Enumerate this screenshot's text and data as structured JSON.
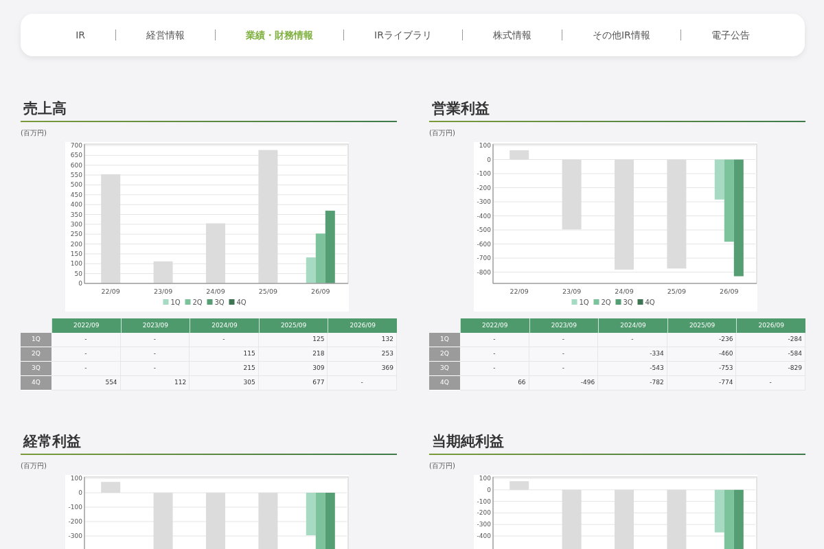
{
  "nav": [
    {
      "label": "IR",
      "selected": false
    },
    {
      "label": "経営情報",
      "selected": false
    },
    {
      "label": "業績・財務情報",
      "selected": true
    },
    {
      "label": "IRライブラリ",
      "selected": false
    },
    {
      "label": "株式情報",
      "selected": false
    },
    {
      "label": "その他IR情報",
      "selected": false
    },
    {
      "label": "電子公告",
      "selected": false
    }
  ],
  "sections": [
    {
      "title": "売上高",
      "unit": "(百万円)",
      "chart_data": {
        "type": "bar",
        "grid": true,
        "legend": true,
        "categories": [
          "22/09",
          "23/09",
          "24/09",
          "25/09",
          "26/09"
        ],
        "ylim": [
          0,
          700
        ],
        "yticks": [
          0,
          50,
          100,
          150,
          200,
          250,
          300,
          350,
          400,
          450,
          500,
          550,
          600,
          650,
          700
        ],
        "series": [
          {
            "name": "1Q",
            "color": "#a6dac3",
            "values": [
              null,
              null,
              null,
              null,
              132
            ]
          },
          {
            "name": "2Q",
            "color": "#7cc39c",
            "values": [
              null,
              null,
              null,
              null,
              253
            ]
          },
          {
            "name": "3Q",
            "color": "#559d72",
            "values": [
              null,
              null,
              null,
              null,
              369
            ]
          },
          {
            "name": "4Q",
            "color": "#3e7452",
            "values": [
              null,
              null,
              null,
              null,
              null
            ]
          },
          {
            "color": "#dcdcdc",
            "values": [
              554,
              112,
              305,
              677,
              null
            ]
          }
        ]
      },
      "table": {
        "columns": [
          "2022/09",
          "2023/09",
          "2024/09",
          "2025/09",
          "2026/09"
        ],
        "rows": [
          {
            "label": "1Q",
            "cells": [
              "-",
              "-",
              "-",
              "125",
              "132"
            ]
          },
          {
            "label": "2Q",
            "cells": [
              "-",
              "-",
              "115",
              "218",
              "253"
            ]
          },
          {
            "label": "3Q",
            "cells": [
              "-",
              "-",
              "215",
              "309",
              "369"
            ]
          },
          {
            "label": "4Q",
            "cells": [
              "554",
              "112",
              "305",
              "677",
              "-"
            ]
          }
        ]
      }
    },
    {
      "title": "営業利益",
      "unit": "(百万円)",
      "chart_data": {
        "type": "bar",
        "grid": true,
        "legend": true,
        "categories": [
          "22/09",
          "23/09",
          "24/09",
          "25/09",
          "26/09"
        ],
        "ylim": [
          -880,
          100
        ],
        "yticks": [
          -800,
          -700,
          -600,
          -500,
          -400,
          -300,
          -200,
          -100,
          0,
          100
        ],
        "series": [
          {
            "name": "1Q",
            "color": "#a6dac3",
            "values": [
              null,
              null,
              null,
              null,
              -284
            ]
          },
          {
            "name": "2Q",
            "color": "#7cc39c",
            "values": [
              null,
              null,
              null,
              null,
              -584
            ]
          },
          {
            "name": "3Q",
            "color": "#559d72",
            "values": [
              null,
              null,
              null,
              null,
              -829
            ]
          },
          {
            "name": "4Q",
            "color": "#3e7452",
            "values": [
              null,
              null,
              null,
              null,
              null
            ]
          },
          {
            "color": "#dcdcdc",
            "values": [
              66,
              -496,
              -782,
              -774,
              null
            ]
          }
        ]
      },
      "table": {
        "columns": [
          "2022/09",
          "2023/09",
          "2024/09",
          "2025/09",
          "2026/09"
        ],
        "rows": [
          {
            "label": "1Q",
            "cells": [
              "-",
              "-",
              "-",
              "-236",
              "-284"
            ]
          },
          {
            "label": "2Q",
            "cells": [
              "-",
              "-",
              "-334",
              "-460",
              "-584"
            ]
          },
          {
            "label": "3Q",
            "cells": [
              "-",
              "-",
              "-543",
              "-753",
              "-829"
            ]
          },
          {
            "label": "4Q",
            "cells": [
              "66",
              "-496",
              "-782",
              "-774",
              "-"
            ]
          }
        ]
      }
    },
    {
      "title": "経常利益",
      "unit": "(百万円)",
      "axis_labels": [
        "100",
        "0",
        "-100",
        "-200",
        "-300"
      ]
    },
    {
      "title": "当期純利益",
      "unit": "(百万円)",
      "axis_labels": [
        "100",
        "0",
        "-100",
        "-200",
        "-300",
        "-400"
      ]
    }
  ]
}
